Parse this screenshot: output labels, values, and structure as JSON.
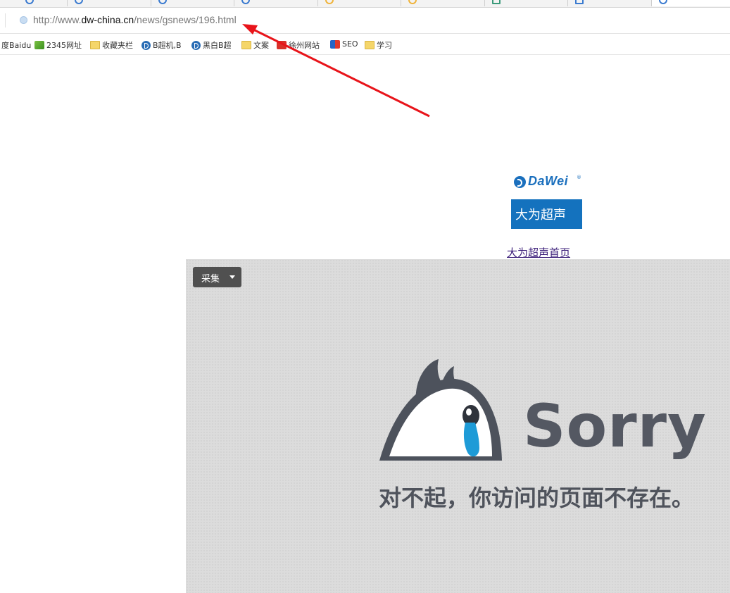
{
  "browser": {
    "address_url_prefix": "http://www.",
    "address_url_domain": "dw-china.cn",
    "address_url_path": "/news/gsnews/196.html",
    "bookmarks": [
      {
        "label": "度Baidu",
        "icon": "baidu-icon"
      },
      {
        "label": "2345网址",
        "icon": "2345-icon"
      },
      {
        "label": "收藏夹栏",
        "icon": "folder-icon"
      },
      {
        "label": "B超机,B",
        "icon": "site-icon"
      },
      {
        "label": "黑白B超",
        "icon": "site-icon"
      },
      {
        "label": "文案",
        "icon": "folder-icon"
      },
      {
        "label": "徐州网站",
        "icon": "site-icon"
      },
      {
        "label": "SEO",
        "icon": "seo-icon"
      },
      {
        "label": "学习",
        "icon": "folder-icon"
      }
    ]
  },
  "page": {
    "logo_brand": "DaWei",
    "logo_reg": "®",
    "logo_text_cn": "大为超声",
    "home_link": "大为超声首页",
    "collect_button": "采集",
    "sorry_title": "Sorry",
    "sorry_message": "对不起，你访问的页面不存在。"
  },
  "colors": {
    "annotation_arrow": "#e8141a",
    "brand_blue": "#1472be",
    "panel_bg": "#dcdcdc",
    "sorry_text": "#545862",
    "tear": "#1e9bd7"
  }
}
